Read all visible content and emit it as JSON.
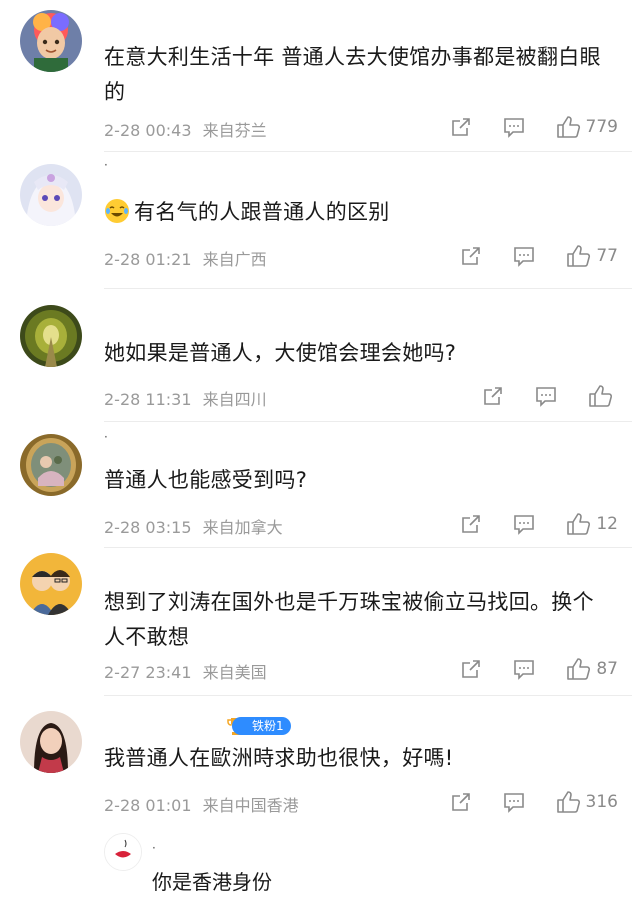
{
  "comments": [
    {
      "nickname": "",
      "text": "在意大利生活十年 普通人去大使馆办事都是被翻白眼的",
      "date": "2-28 00:43",
      "location": "来自芬兰",
      "likes": "779",
      "avatar_icon": "boy-cartoon-avatar"
    },
    {
      "nickname": "·",
      "text": "有名气的人跟普通人的区别",
      "emoji": "crying-laughing-emoji",
      "date": "2-28 01:21",
      "location": "来自广西",
      "likes": "77",
      "avatar_icon": "anime-girl-avatar"
    },
    {
      "nickname": "",
      "text": "她如果是普通人，大使馆会理会她吗?",
      "date": "2-28 11:31",
      "location": "来自四川",
      "likes": "",
      "avatar_icon": "forest-tunnel-avatar"
    },
    {
      "nickname": "·",
      "text": "普通人也能感受到吗?",
      "date": "2-28 03:15",
      "location": "来自加拿大",
      "likes": "12",
      "avatar_icon": "painting-avatar"
    },
    {
      "nickname": "",
      "text": "想到了刘涛在国外也是千万珠宝被偷立马找回。换个人不敢想",
      "date": "2-27 23:41",
      "location": "来自美国",
      "likes": "87",
      "avatar_icon": "couple-cartoon-avatar"
    },
    {
      "nickname": "",
      "badge": "铁粉1",
      "text": "我普通人在歐洲時求助也很快，好嗎!",
      "date": "2-28 01:01",
      "location": "来自中国香港",
      "likes": "316",
      "avatar_icon": "woman-photo-avatar"
    }
  ],
  "reply": {
    "nickname": "·",
    "text": "你是香港身份",
    "avatar_icon": "red-lips-avatar"
  },
  "colors": {
    "meta_gray": "#9a9a9a",
    "divider": "#ececec",
    "badge_blue": "#2e8cff"
  }
}
